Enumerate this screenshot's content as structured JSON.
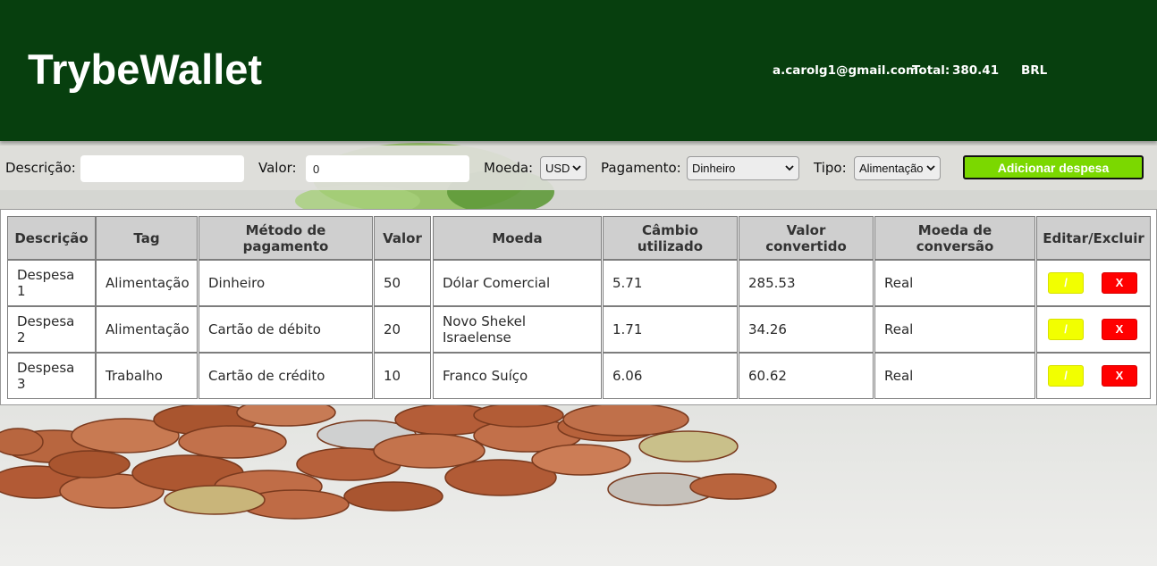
{
  "header": {
    "title": "TrybeWallet",
    "email": "a.carolg1@gmail.com",
    "total_label": "Total:",
    "total_value": "380.41",
    "currency": "BRL"
  },
  "form": {
    "description_label": "Descrição:",
    "description_value": "",
    "value_label": "Valor:",
    "value_value": "0",
    "currency_label": "Moeda:",
    "currency_selected": "USD",
    "payment_label": "Pagamento:",
    "payment_selected": "Dinheiro",
    "type_label": "Tipo:",
    "type_selected": "Alimentação",
    "add_button": "Adicionar despesa"
  },
  "table": {
    "headers": [
      "Descrição",
      "Tag",
      "Método de pagamento",
      "Valor",
      "Moeda",
      "Câmbio utilizado",
      "Valor convertido",
      "Moeda de conversão",
      "Editar/Excluir"
    ],
    "rows": [
      {
        "description": "Despesa 1",
        "tag": "Alimentação",
        "method": "Dinheiro",
        "value": "50",
        "currency": "Dólar Comercial",
        "rate": "5.71",
        "converted": "285.53",
        "conversion_currency": "Real",
        "edit": "/",
        "delete": "X"
      },
      {
        "description": "Despesa 2",
        "tag": "Alimentação",
        "method": "Cartão de débito",
        "value": "20",
        "currency": "Novo Shekel Israelense",
        "rate": "1.71",
        "converted": "34.26",
        "conversion_currency": "Real",
        "edit": "/",
        "delete": "X"
      },
      {
        "description": "Despesa 3",
        "tag": "Trabalho",
        "method": "Cartão de crédito",
        "value": "10",
        "currency": "Franco Suíço",
        "rate": "6.06",
        "converted": "60.62",
        "conversion_currency": "Real",
        "edit": "/",
        "delete": "X"
      }
    ]
  },
  "colors": {
    "header_bg": "#073f0e",
    "add_button_bg": "#7bd800",
    "edit_button_bg": "#f2ff00",
    "delete_button_bg": "#ff0000",
    "table_header_bg": "#cfcfcf"
  },
  "icons": {
    "select_arrow": "chevron-down-icon"
  }
}
